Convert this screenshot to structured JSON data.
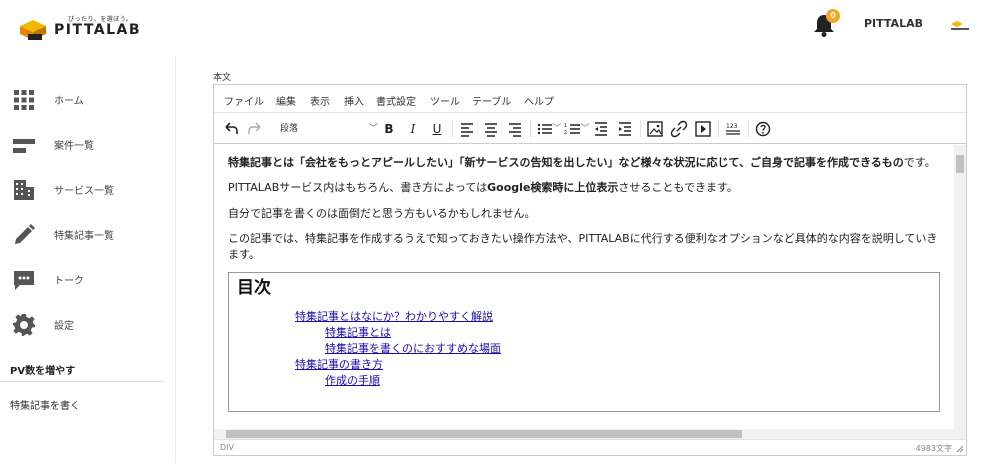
{
  "header": {
    "logo_tagline": "ぴったり、を選ぼう。",
    "logo_text": "PITTALAB",
    "notifications_count": "0",
    "username": "PITTALAB",
    "bell_icon": "bell-icon",
    "avatar_icon": "avatar"
  },
  "sidebar": {
    "items": [
      {
        "label": "ホーム",
        "icon": "grid-icon"
      },
      {
        "label": "案件一覧",
        "icon": "list-icon"
      },
      {
        "label": "サービス一覧",
        "icon": "building-icon"
      },
      {
        "label": "特集記事一覧",
        "icon": "pencil-icon"
      },
      {
        "label": "トーク",
        "icon": "chat-icon"
      },
      {
        "label": "設定",
        "icon": "gear-icon"
      }
    ],
    "section_title": "PV数を増やす",
    "section_link": "特集記事を書く"
  },
  "editor": {
    "field_label": "本文",
    "menu": [
      "ファイル",
      "編集",
      "表示",
      "挿入",
      "書式設定",
      "ツール",
      "テーブル",
      "ヘルプ"
    ],
    "format_select": "段落",
    "toolbar": {
      "bold": "B",
      "italic": "I",
      "underline": "U"
    },
    "content": {
      "p1_bold": "特集記事とは「会社をもっとアピールしたい」「新サービスの告知を出したい」など様々な状況に応じて、ご自身で記事を作成できるもの",
      "p1_rest": "です。",
      "p2_pre": "PITTALABサービス内はもちろん、書き方によっては",
      "p2_bold": "Google検索時に上位表示",
      "p2_post": "させることもできます。",
      "p3": "自分で記事を書くのは面倒だと思う方もいるかもしれません。",
      "p4": "この記事では、特集記事を作成するうえで知っておきたい操作方法や、PITTALABに代行する便利なオプションなど具体的な内容を説明していきます。",
      "toc_title": "目次",
      "toc": [
        {
          "text": "特集記事とはなにか？わかりやすく解説",
          "level": 1
        },
        {
          "text": "特集記事とは",
          "level": 2
        },
        {
          "text": "特集記事を書くのにおすすめな場面",
          "level": 2
        },
        {
          "text": "特集記事の書き方",
          "level": 1
        },
        {
          "text": "作成の手順",
          "level": 2
        }
      ]
    },
    "status": {
      "path": "DIV",
      "word_count": "4983文字"
    }
  },
  "colors": {
    "accent": "#f5a623",
    "link": "#1a0dab"
  }
}
